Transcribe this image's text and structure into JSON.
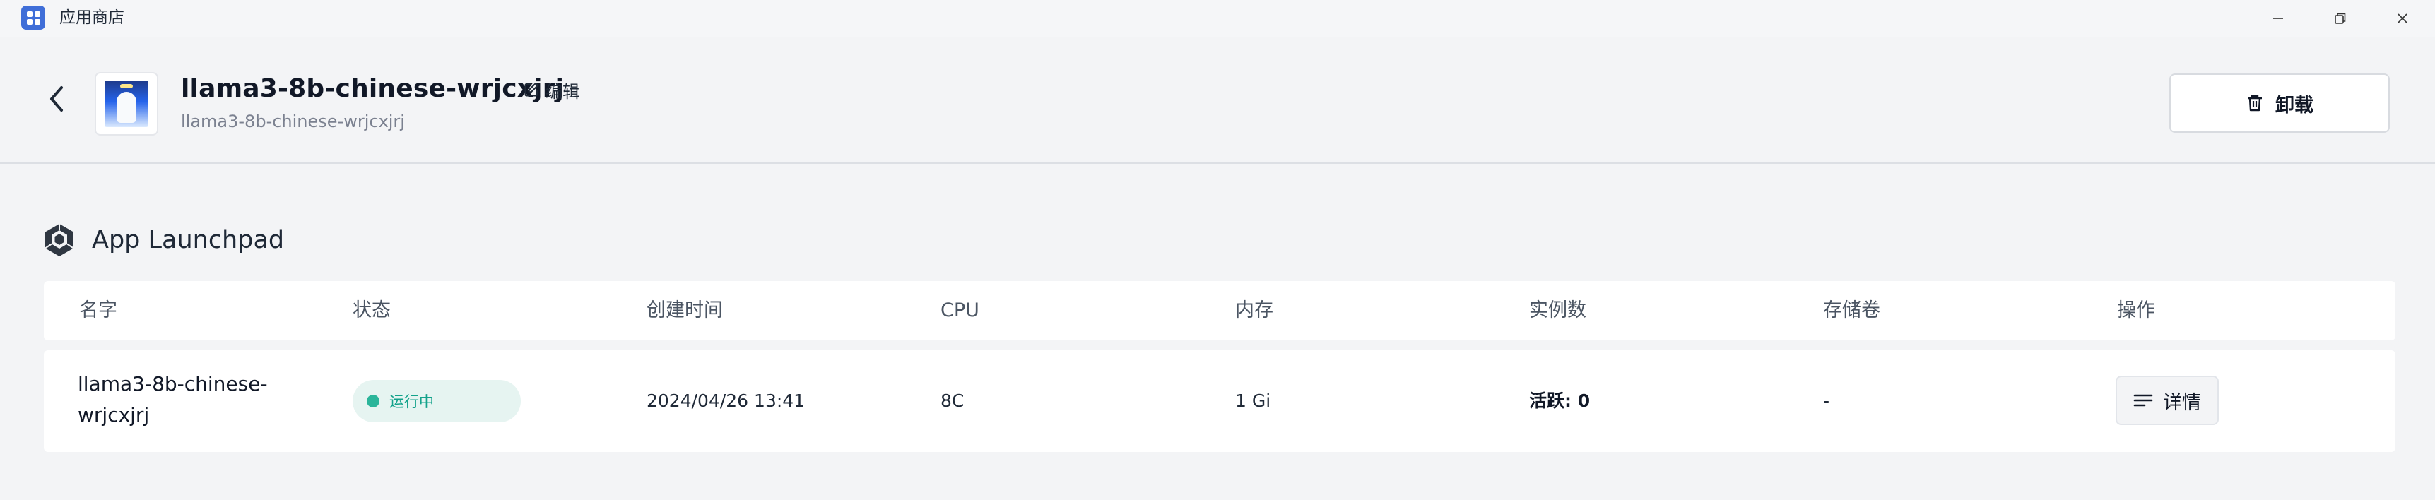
{
  "window": {
    "title": "应用商店",
    "icons": [
      "app-store-icon",
      "minimize-icon",
      "maximize-icon",
      "close-icon"
    ]
  },
  "header": {
    "app_name": "llama3-8b-chinese-wrjcxjrj",
    "app_subtitle": "llama3-8b-chinese-wrjcxjrj",
    "edit_label": "编辑",
    "uninstall_label": "卸载"
  },
  "section": {
    "title": "App Launchpad",
    "icon": "hexagon-cube-icon"
  },
  "table": {
    "columns": [
      "名字",
      "状态",
      "创建时间",
      "CPU",
      "内存",
      "实例数",
      "存储卷",
      "操作"
    ],
    "rows": [
      {
        "name": "llama3-8b-chinese-wrjcxjrj",
        "status": "运行中",
        "created": "2024/04/26 13:41",
        "cpu": "8C",
        "memory": "1 Gi",
        "instances": "活跃: 0",
        "volume": "-",
        "action": "详情"
      }
    ]
  },
  "colors": {
    "accent": "#3f6ed8",
    "status_running": "#2bb59a",
    "status_bg": "#e6f4f1"
  }
}
